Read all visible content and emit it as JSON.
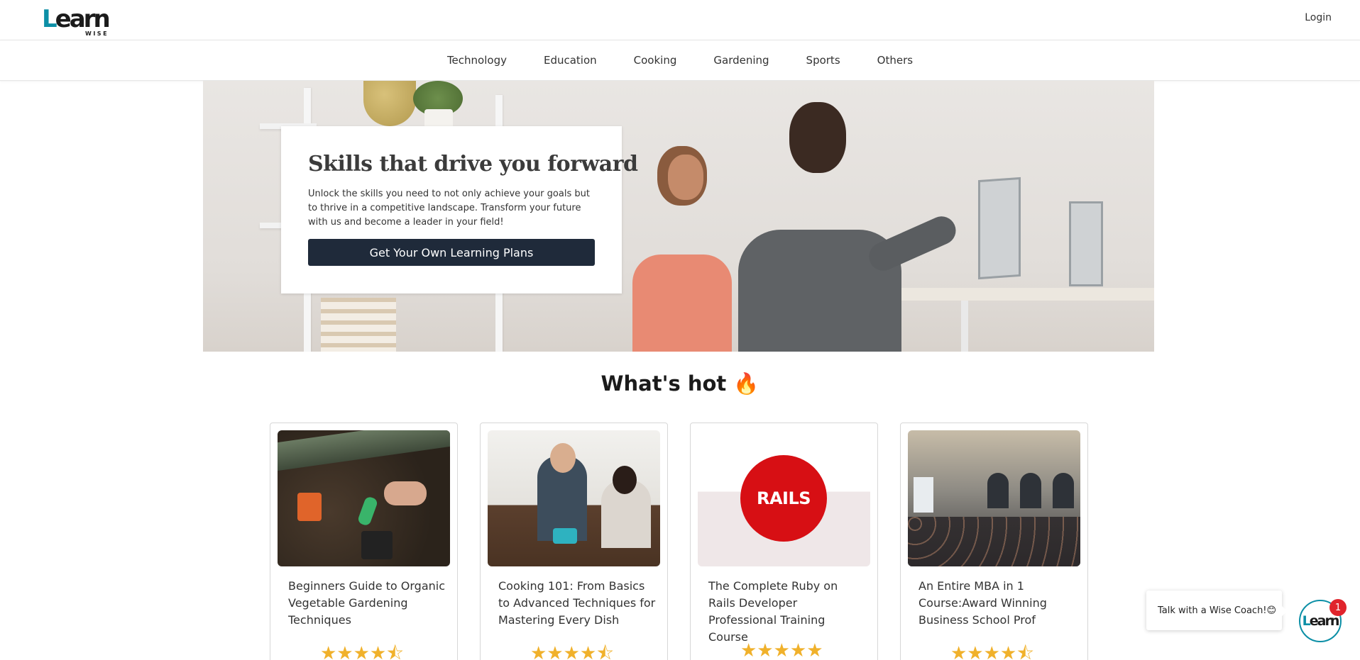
{
  "header": {
    "logo_main": "Learn",
    "logo_sub": "WISE",
    "login_label": "Login"
  },
  "categories": [
    "Technology",
    "Education",
    "Cooking",
    "Gardening",
    "Sports",
    "Others"
  ],
  "hero": {
    "title": "Skills that drive you forward",
    "text": "Unlock the skills you need to not only achieve your goals but to thrive in a competitive landscape. Transform your future with us and become a leader in your field!",
    "button_label": "Get Your Own Learning Plans"
  },
  "hot": {
    "title": "What's hot 🔥",
    "courses": [
      {
        "title": "Beginners Guide to Organic Vegetable Gardening Techniques",
        "rating": 4.5,
        "stars": "★★★★⯪"
      },
      {
        "title": "Cooking 101: From Basics to Advanced Techniques for Mastering Every Dish",
        "rating": 4.5,
        "stars": "★★★★⯪"
      },
      {
        "title": "The Complete Ruby on Rails Developer Professional Training Course",
        "rating": 5,
        "stars": "★★★★★",
        "image_text": "RAILS"
      },
      {
        "title": "An Entire MBA in 1 Course:Award Winning Business School Prof",
        "rating": 4.5,
        "stars": "★★★★⯪"
      }
    ]
  },
  "chat": {
    "prompt": "Talk with a Wise Coach!😊",
    "badge_count": "1"
  },
  "colors": {
    "accent": "#0c8fa6",
    "button_dark": "#1f2a3a",
    "star": "#f0b12b",
    "badge": "#e0242c"
  }
}
